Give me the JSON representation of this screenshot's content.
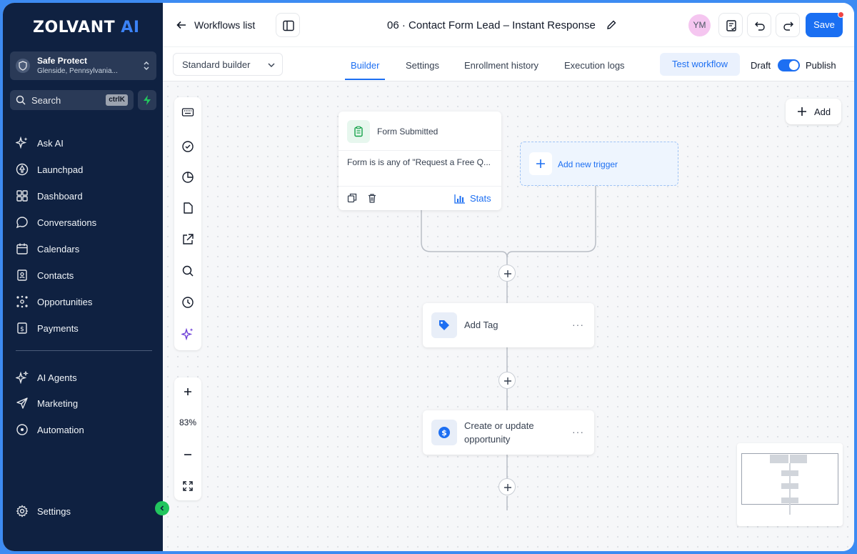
{
  "brand": {
    "name_main": "ZOLVANT",
    "name_ai": "AI"
  },
  "location": {
    "name": "Safe Protect",
    "address": "Glenside, Pennsylvania..."
  },
  "search": {
    "label": "Search",
    "shortcut": "ctrlK"
  },
  "sidebar": {
    "items": [
      {
        "label": "Ask AI",
        "icon": "sparkle-icon"
      },
      {
        "label": "Launchpad",
        "icon": "rocket-icon"
      },
      {
        "label": "Dashboard",
        "icon": "grid-icon"
      },
      {
        "label": "Conversations",
        "icon": "chat-icon"
      },
      {
        "label": "Calendars",
        "icon": "calendar-icon"
      },
      {
        "label": "Contacts",
        "icon": "contacts-icon"
      },
      {
        "label": "Opportunities",
        "icon": "network-icon"
      },
      {
        "label": "Payments",
        "icon": "dollar-doc-icon"
      }
    ],
    "secondary": [
      {
        "label": "AI Agents",
        "icon": "sparkle-outline-icon"
      },
      {
        "label": "Marketing",
        "icon": "send-icon"
      },
      {
        "label": "Automation",
        "icon": "target-icon"
      }
    ],
    "settings": "Settings"
  },
  "header": {
    "back_label": "Workflows list",
    "title": "06 · Contact Form Lead – Instant Response",
    "avatar": "YM",
    "save": "Save"
  },
  "subbar": {
    "builder_select": "Standard builder",
    "tabs": [
      "Builder",
      "Settings",
      "Enrollment history",
      "Execution logs"
    ],
    "active_tab": "Builder",
    "test_button": "Test workflow",
    "draft": "Draft",
    "publish": "Publish",
    "published": true
  },
  "canvas": {
    "add_button": "Add",
    "zoom": "83%",
    "trigger": {
      "title": "Form Submitted",
      "condition": "Form is is any of \"Request a Free Q...",
      "stats": "Stats"
    },
    "add_trigger": "Add new trigger",
    "actions": [
      {
        "label_lines": [
          "Add Tag"
        ],
        "icon": "tag-icon"
      },
      {
        "label_lines": [
          "Create or update",
          "opportunity"
        ],
        "icon": "dollar-circle-icon"
      }
    ]
  },
  "colors": {
    "accent": "#1a6ff2",
    "sidebar": "#0f2141",
    "frame": "#3d8bf2"
  }
}
